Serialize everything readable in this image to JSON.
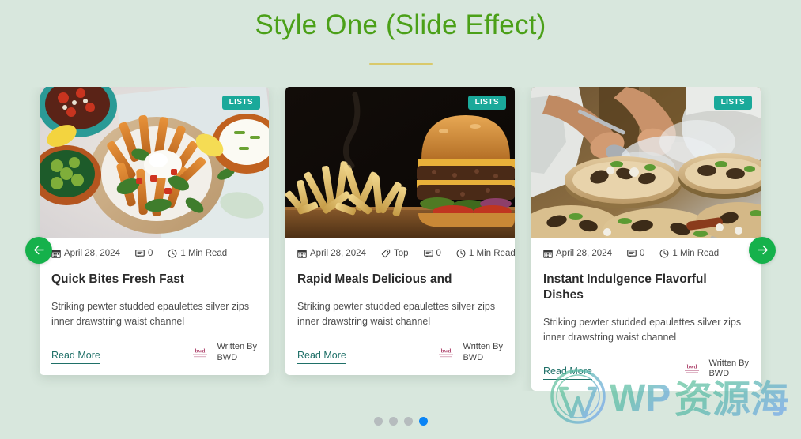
{
  "page": {
    "title": "Style One (Slide Effect)",
    "background_color": "#d8e7dd",
    "title_color": "#4ba018",
    "underline_color": "#d9c96b"
  },
  "carousel": {
    "prev_label": "Previous slide",
    "next_label": "Next slide",
    "arrow_color": "#15b14b",
    "dots": [
      {
        "label": "Go to slide 1",
        "active": false
      },
      {
        "label": "Go to slide 2",
        "active": false
      },
      {
        "label": "Go to slide 3",
        "active": false
      },
      {
        "label": "Go to slide 4",
        "active": true
      }
    ],
    "dot_color": "#b6bcbe",
    "dot_active_color": "#0a84f5",
    "cards": [
      {
        "badge": "LISTS",
        "image_alt": "Loaded fries bowl with salsa, guacamole and sour cream",
        "date": "April 28, 2024",
        "tag": null,
        "comments": "0",
        "read_time": "1 Min Read",
        "title": "Quick Bites Fresh Fast",
        "excerpt": "Striking pewter studded epaulettes silver zips inner drawstring waist channel",
        "read_more": "Read More",
        "author_prefix": "Written By",
        "author_name": "BWD"
      },
      {
        "badge": "LISTS",
        "image_alt": "Double cheeseburger with french fries on a wooden board",
        "date": "April 28, 2024",
        "tag": "Top",
        "comments": "0",
        "read_time": "1 Min Read",
        "title": "Rapid Meals Delicious and",
        "excerpt": "Striking pewter studded epaulettes silver zips inner drawstring waist channel",
        "read_more": "Read More",
        "author_prefix": "Written By",
        "author_name": "BWD"
      },
      {
        "badge": "LISTS",
        "image_alt": "Chef plating gourmet food on wood slices with smoke",
        "date": "April 28, 2024",
        "tag": null,
        "comments": "0",
        "read_time": "1 Min Read",
        "title": "Instant Indulgence Flavorful Dishes",
        "excerpt": "Striking pewter studded epaulettes silver zips inner drawstring waist channel",
        "read_more": "Read More",
        "author_prefix": "Written By",
        "author_name": "BWD"
      }
    ]
  },
  "watermark": {
    "latin_text": "WP",
    "cjk_text": "资源海"
  }
}
